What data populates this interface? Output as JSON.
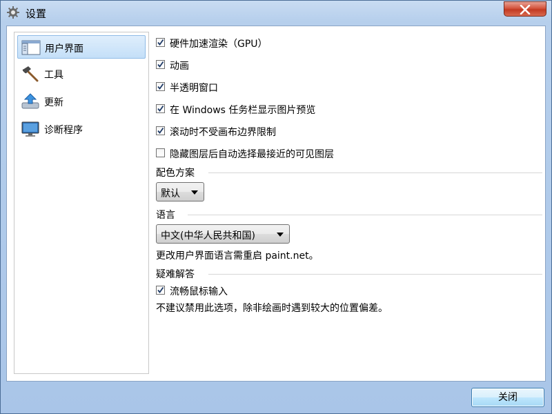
{
  "window": {
    "title": "设置",
    "close_button_label": "",
    "title_icon": "gear-icon"
  },
  "sidebar": {
    "items": [
      {
        "label": "用户界面",
        "icon": "window-layout-icon",
        "active": true
      },
      {
        "label": "工具",
        "icon": "hammer-icon",
        "active": false
      },
      {
        "label": "更新",
        "icon": "update-arrow-icon",
        "active": false
      },
      {
        "label": "诊断程序",
        "icon": "monitor-icon",
        "active": false
      }
    ]
  },
  "options": {
    "gpu": {
      "label": "硬件加速渲染（GPU）",
      "checked": true
    },
    "animation": {
      "label": "动画",
      "checked": true
    },
    "translucent": {
      "label": "半透明窗口",
      "checked": true
    },
    "taskbar_preview": {
      "label": "在 Windows 任务栏显示图片预览",
      "checked": true
    },
    "scroll_unbound": {
      "label": "滚动时不受画布边界限制",
      "checked": true
    },
    "hide_layer": {
      "label": "隐藏图层后自动选择最接近的可见图层",
      "checked": false
    }
  },
  "color_scheme": {
    "section_label": "配色方案",
    "selected": "默认"
  },
  "language": {
    "section_label": "语言",
    "selected": "中文(中华人民共和国)",
    "note": "更改用户界面语言需重启 paint.net。"
  },
  "troubleshooting": {
    "section_label": "疑难解答",
    "smooth_mouse": {
      "label": "流畅鼠标输入",
      "checked": true
    },
    "note": "不建议禁用此选项，除非绘画时遇到较大的位置偏差。"
  },
  "footer": {
    "close_label": "关闭"
  },
  "colors": {
    "frame": "#b6cfec",
    "selection": "#c4dff8",
    "close_red": "#c23a22",
    "accent_button": "#bee6fd"
  }
}
